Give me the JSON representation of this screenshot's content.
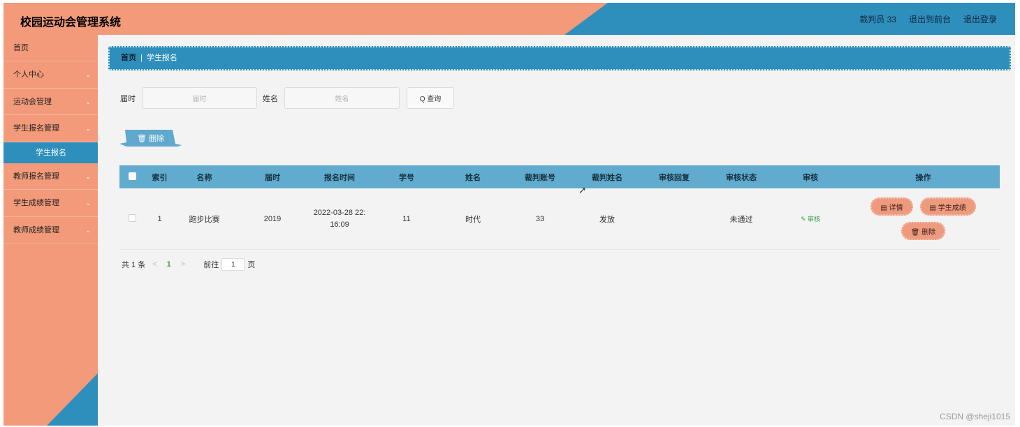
{
  "header": {
    "title": "校园运动会管理系统",
    "user": "裁判员 33",
    "back_to_front": "退出到前台",
    "logout": "退出登录"
  },
  "sidebar": {
    "items": [
      {
        "label": "首页"
      },
      {
        "label": "个人中心"
      },
      {
        "label": "运动会管理"
      },
      {
        "label": "学生报名管理"
      },
      {
        "label": "学生报名",
        "sub": true
      },
      {
        "label": "教师报名管理"
      },
      {
        "label": "学生成绩管理"
      },
      {
        "label": "教师成绩管理"
      }
    ],
    "chevron": "⌄"
  },
  "breadcrumb": {
    "home": "首页",
    "current": "学生报名"
  },
  "search": {
    "field1_label": "届时",
    "field1_placeholder": "届时",
    "field2_label": "姓名",
    "field2_placeholder": "姓名",
    "query_label": "Q 查询"
  },
  "toolbar": {
    "delete_label": "🗑 删除"
  },
  "table": {
    "headers": [
      "索引",
      "名称",
      "届时",
      "报名时间",
      "学号",
      "姓名",
      "裁判账号",
      "裁判姓名",
      "审核回复",
      "审核状态",
      "审核",
      "操作"
    ],
    "rows": [
      {
        "index": "1",
        "name": "跑步比赛",
        "session": "2019",
        "time_line1": "2022-03-28 22:",
        "time_line2": "16:09",
        "student_no": "11",
        "student_name": "时代",
        "judge_account": "33",
        "judge_name": "发放",
        "reply": "",
        "status": "未通过",
        "audit": "✎ 审核",
        "actions": {
          "detail": "▤ 详情",
          "score": "▤ 学生成绩",
          "delete": "🗑 删除"
        }
      }
    ]
  },
  "pager": {
    "total": "共 1 条",
    "prev": "<",
    "current": "1",
    "next": ">",
    "goto": "前往",
    "page_value": "1",
    "page_suffix": "页"
  },
  "watermark": "CSDN @sheji1015"
}
